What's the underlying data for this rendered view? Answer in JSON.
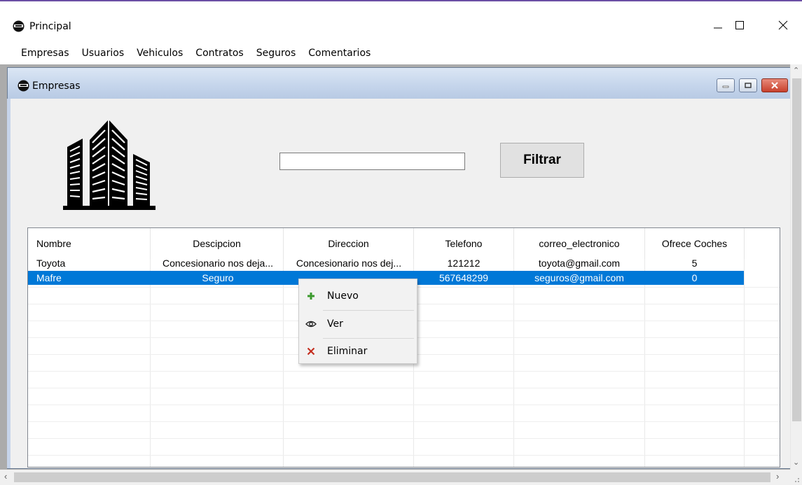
{
  "window": {
    "title": "Principal"
  },
  "menubar": {
    "items": [
      "Empresas",
      "Usuarios",
      "Vehiculos",
      "Contratos",
      "Seguros",
      "Comentarios"
    ]
  },
  "child": {
    "title": "Empresas"
  },
  "filter": {
    "input_value": "",
    "button_label": "Filtrar"
  },
  "grid": {
    "columns": [
      "Nombre",
      "Descipcion",
      "Direccion",
      "Telefono",
      "correo_electronico",
      "Ofrece Coches"
    ],
    "rows": [
      [
        "Toyota",
        "Concesionario nos deja...",
        "Concesionario nos dej...",
        "121212",
        "toyota@gmail.com",
        "5"
      ],
      [
        "Mafre",
        "Seguro",
        "",
        "567648299",
        "seguros@gmail.com",
        "0"
      ]
    ],
    "selected_row": 1
  },
  "context_menu": {
    "items": [
      {
        "label": "Nuevo",
        "icon": "plus-icon"
      },
      {
        "label": "Ver",
        "icon": "eye-icon"
      },
      {
        "label": "Eliminar",
        "icon": "delete-x-icon"
      }
    ]
  },
  "colors": {
    "selection": "#0078d7",
    "accent_line": "#6b4fa5",
    "plus": "#3c9a2e",
    "delete": "#c42b1c"
  }
}
